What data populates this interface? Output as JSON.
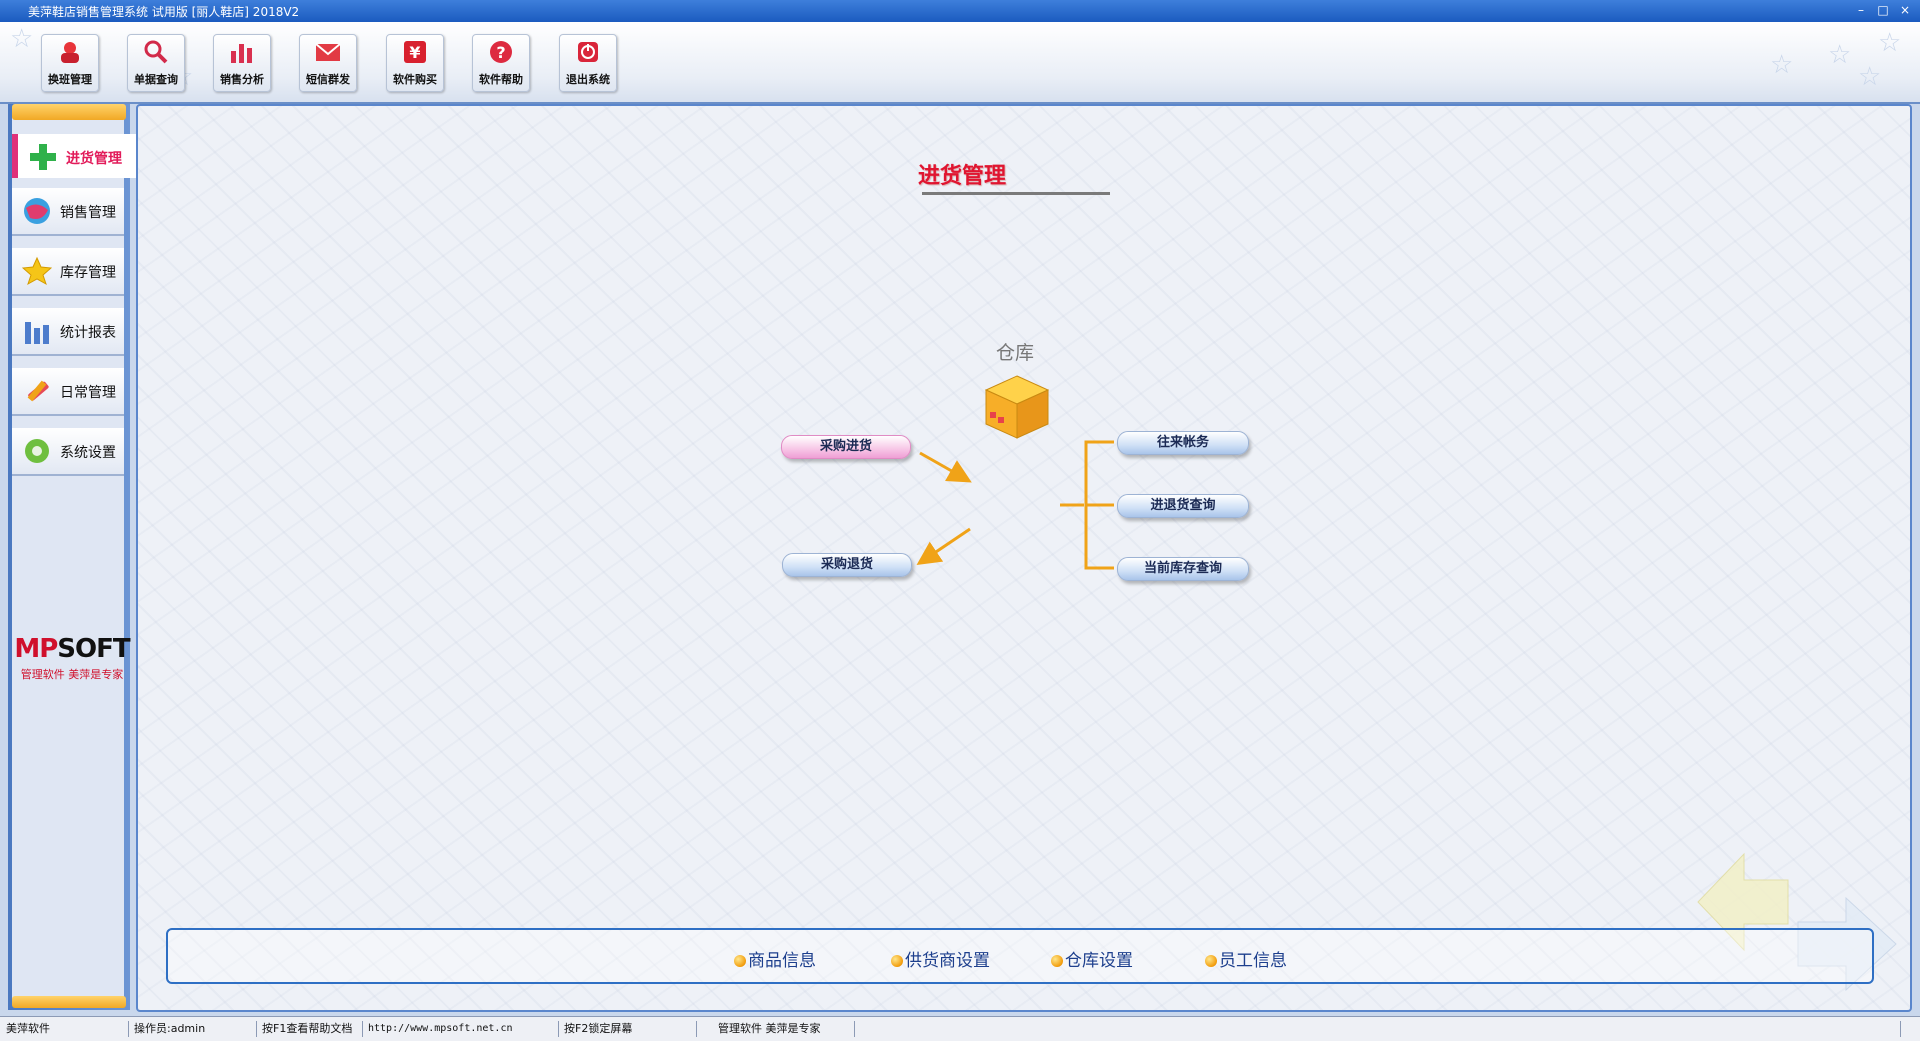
{
  "window": {
    "title": "美萍鞋店销售管理系统 试用版 [丽人鞋店] 2018V2",
    "minimize": "–",
    "maximize": "□",
    "close": "×"
  },
  "toolbar": {
    "buttons": [
      {
        "label": "换班管理",
        "icon": "shift-change-icon"
      },
      {
        "label": "单据查询",
        "icon": "magnifier-icon"
      },
      {
        "label": "销售分析",
        "icon": "bar-chart-icon"
      },
      {
        "label": "短信群发",
        "icon": "envelope-icon"
      },
      {
        "label": "软件购买",
        "icon": "yen-icon"
      },
      {
        "label": "软件帮助",
        "icon": "help-icon"
      },
      {
        "label": "退出系统",
        "icon": "power-icon"
      }
    ]
  },
  "sidebar": {
    "active": {
      "label": "进货管理",
      "icon": "plus-icon"
    },
    "items": [
      {
        "label": "销售管理",
        "icon": "globe-icon"
      },
      {
        "label": "库存管理",
        "icon": "star-icon"
      },
      {
        "label": "统计报表",
        "icon": "bars-icon"
      },
      {
        "label": "日常管理",
        "icon": "tools-icon"
      },
      {
        "label": "系统设置",
        "icon": "gear-icon"
      }
    ],
    "brand": {
      "logo": "MPSOFT",
      "tagline": "管理软件 美萍是专家"
    }
  },
  "main": {
    "title": "进货管理",
    "warehouse_label": "仓库",
    "left_links": [
      "采购进货",
      "采购退货"
    ],
    "right_links": [
      "往来帐务",
      "进退货查询",
      "当前库存查询"
    ],
    "shortcuts": [
      "商品信息",
      "供货商设置",
      "仓库设置",
      "员工信息"
    ]
  },
  "status": {
    "cells": [
      "美萍软件",
      "操作员:admin",
      "按F1查看帮助文档",
      "http://www.mpsoft.net.cn",
      "按F2锁定屏幕",
      "管理软件 美萍是专家",
      ""
    ]
  },
  "colors": {
    "accent": "#e01530",
    "link": "#1d3f8d",
    "connector": "#f0a318",
    "frame": "#2e6fc4"
  }
}
